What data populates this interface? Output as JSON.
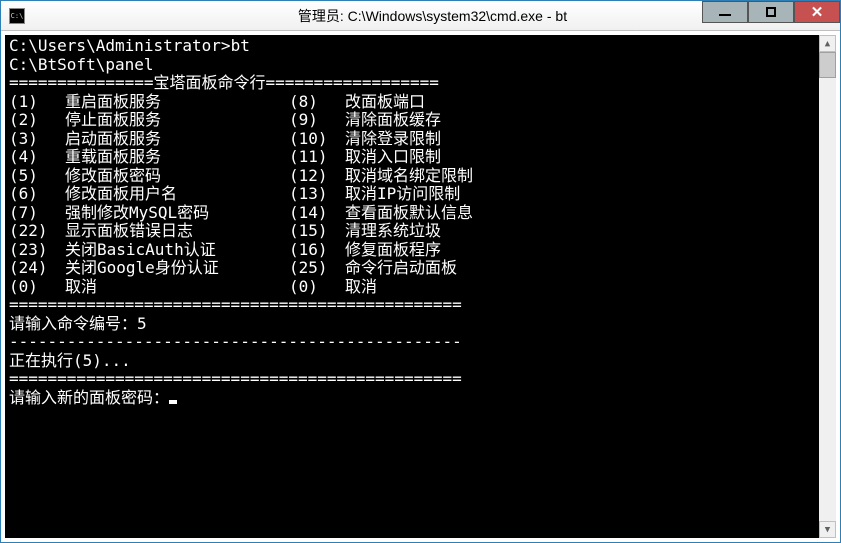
{
  "window": {
    "title": "管理员: C:\\Windows\\system32\\cmd.exe - bt"
  },
  "console": {
    "line1_prompt": "C:\\Users\\Administrator>",
    "line1_cmd": "bt",
    "line2": "C:\\BtSoft\\panel",
    "header_left": "===============",
    "header_title": "宝塔面板命令行",
    "header_right": "==================",
    "menu_left": [
      {
        "n": "(1)",
        "t": "重启面板服务"
      },
      {
        "n": "(2)",
        "t": "停止面板服务"
      },
      {
        "n": "(3)",
        "t": "启动面板服务"
      },
      {
        "n": "(4)",
        "t": "重载面板服务"
      },
      {
        "n": "(5)",
        "t": "修改面板密码"
      },
      {
        "n": "(6)",
        "t": "修改面板用户名"
      },
      {
        "n": "(7)",
        "t": "强制修改MySQL密码"
      },
      {
        "n": "(22)",
        "t": "显示面板错误日志"
      },
      {
        "n": "(23)",
        "t": "关闭BasicAuth认证"
      },
      {
        "n": "(24)",
        "t": "关闭Google身份认证"
      },
      {
        "n": "(0)",
        "t": "取消"
      }
    ],
    "menu_right": [
      {
        "n": "(8)",
        "t": "改面板端口"
      },
      {
        "n": "(9)",
        "t": "清除面板缓存"
      },
      {
        "n": "(10)",
        "t": "清除登录限制"
      },
      {
        "n": "(11)",
        "t": "取消入口限制"
      },
      {
        "n": "(12)",
        "t": "取消域名绑定限制"
      },
      {
        "n": "(13)",
        "t": "取消IP访问限制"
      },
      {
        "n": "(14)",
        "t": "查看面板默认信息"
      },
      {
        "n": "(15)",
        "t": "清理系统垃圾"
      },
      {
        "n": "(16)",
        "t": "修复面板程序"
      },
      {
        "n": "(25)",
        "t": "命令行启动面板"
      },
      {
        "n": "(0)",
        "t": "取消"
      }
    ],
    "footer_sep": "===============================================",
    "prompt1_label": "请输入命令编号：",
    "prompt1_value": "5",
    "dash_sep": "-----------------------------------------------",
    "executing": "正在执行(5)...",
    "eq_sep2": "===============================================",
    "prompt2": "请输入新的面板密码："
  }
}
